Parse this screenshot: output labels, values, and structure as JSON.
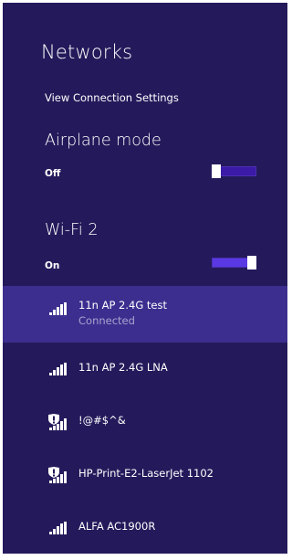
{
  "panel": {
    "title": "Networks",
    "view_settings": "View Connection Settings"
  },
  "airplane": {
    "title": "Airplane mode",
    "state": "Off"
  },
  "wifi": {
    "title": "Wi-Fi 2",
    "state": "On"
  },
  "networks": [
    {
      "name": "11n AP 2.4G test",
      "status": "Connected",
      "secured": false,
      "icon": "wifi-signal-icon"
    },
    {
      "name": "11n AP 2.4G LNA",
      "status": "",
      "secured": false,
      "icon": "wifi-signal-icon"
    },
    {
      "name": "!@#$^&",
      "status": "",
      "secured": true,
      "icon": "wifi-shield-warning-icon"
    },
    {
      "name": "HP-Print-E2-LaserJet 1102",
      "status": "",
      "secured": true,
      "icon": "wifi-shield-warning-icon"
    },
    {
      "name": "ALFA AC1900R",
      "status": "",
      "secured": false,
      "icon": "wifi-signal-icon"
    }
  ],
  "colors": {
    "panel_bg": "#241a5b",
    "selected_bg": "#3c2e8f",
    "toggle_track": "#4a2fb1",
    "text": "#ffffff",
    "subtext": "#a9a3cf"
  }
}
